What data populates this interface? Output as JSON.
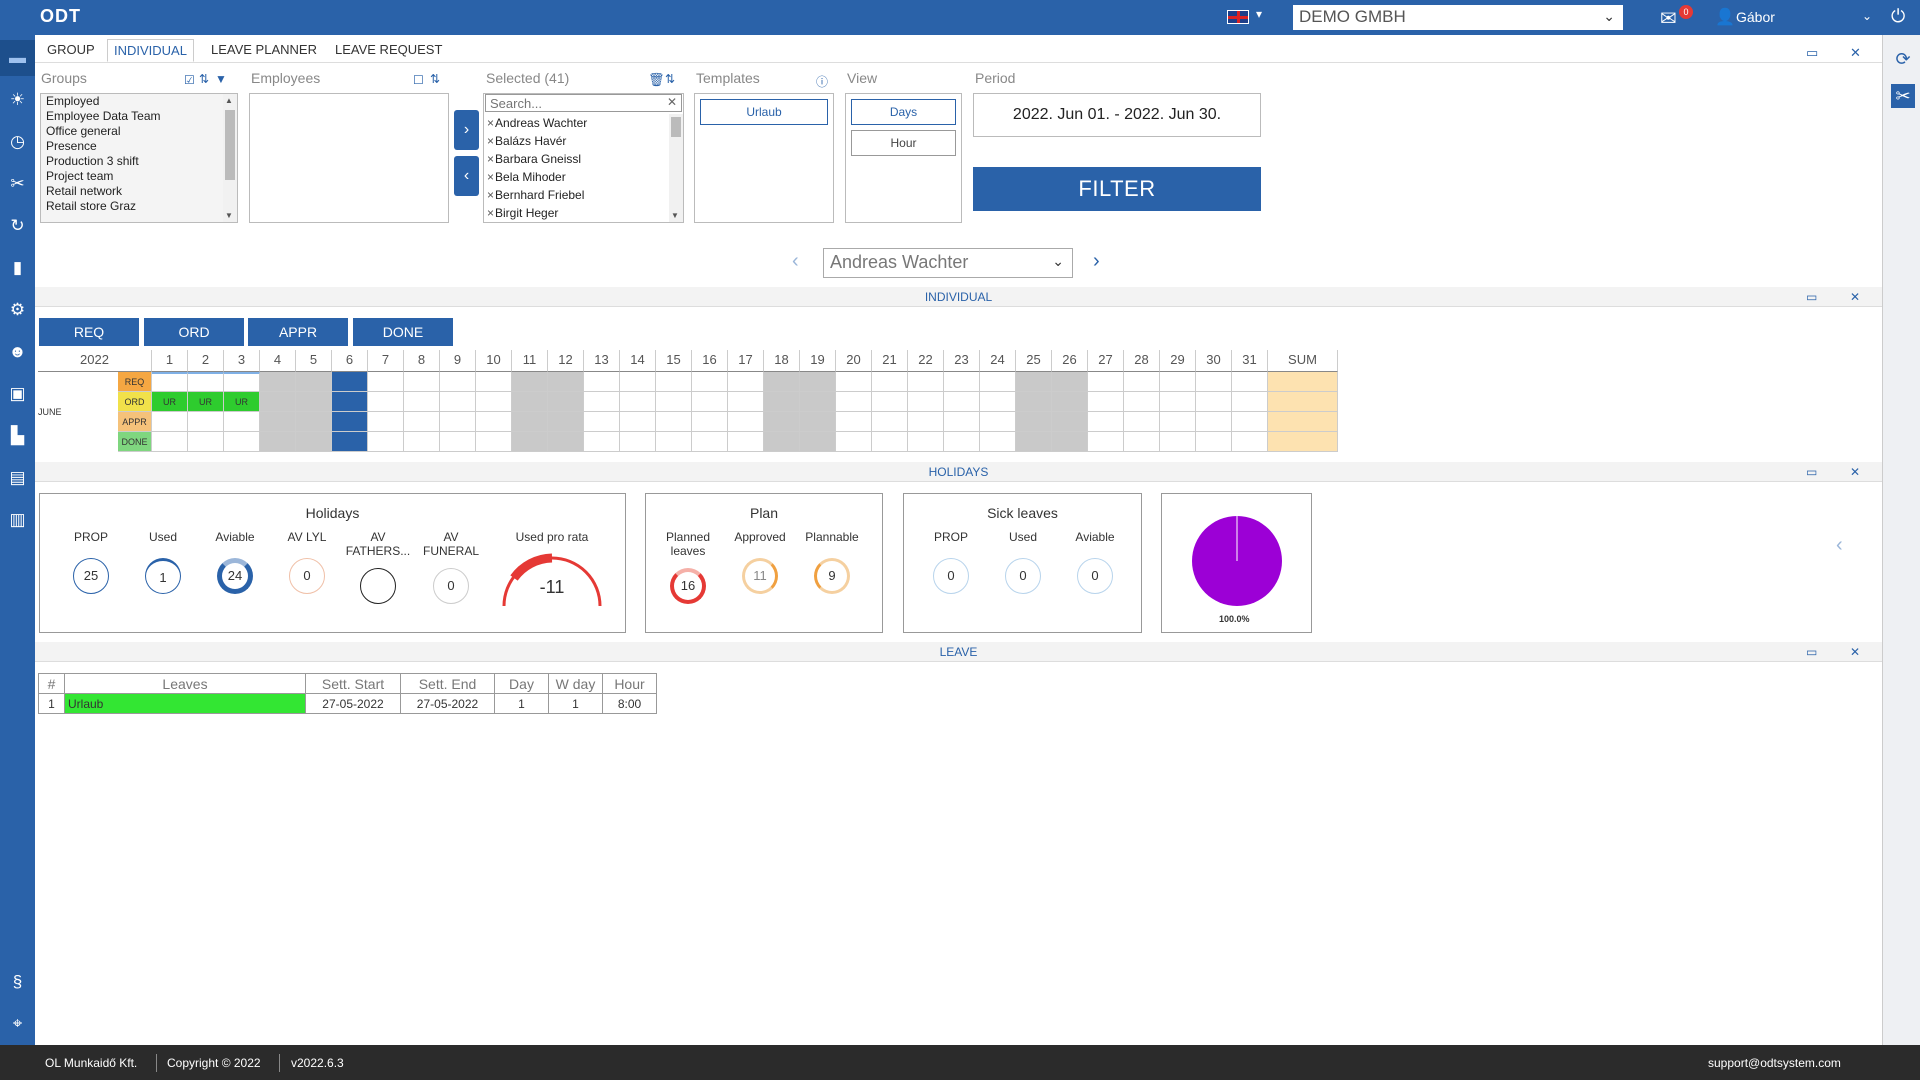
{
  "app": {
    "logo": "ODT",
    "company": "DEMO GMBH",
    "mail_count": "0",
    "user": "Gábor"
  },
  "tabs": [
    "GROUP",
    "INDIVIDUAL",
    "LEAVE PLANNER",
    "LEAVE REQUEST"
  ],
  "filter": {
    "groups_label": "Groups",
    "groups": [
      "Employed",
      "Employee Data Team",
      "Office general",
      "Presence",
      "Production 3 shift",
      "Project team",
      "Retail network",
      "Retail store Graz"
    ],
    "employees_label": "Employees",
    "selected_label": "Selected (41)",
    "search_placeholder": "Search...",
    "selected": [
      "Andreas Wachter",
      "Balázs Havér",
      "Barbara Gneissl",
      "Bela Mihoder",
      "Bernhard Friebel",
      "Birgit Heger"
    ],
    "templates_label": "Templates",
    "template": "Urlaub",
    "view_label": "View",
    "view_days": "Days",
    "view_hour": "Hour",
    "period_label": "Period",
    "period": "2022. Jun 01. - 2022. Jun 30.",
    "filter_button": "FILTER",
    "employee": "Andreas Wachter"
  },
  "sections": {
    "individual": "INDIVIDUAL",
    "holidays": "HOLIDAYS",
    "leave": "LEAVE"
  },
  "status_buttons": [
    "REQ",
    "ORD",
    "APPR",
    "DONE"
  ],
  "calendar": {
    "year": "2022",
    "month": "JUNE",
    "days": [
      "1",
      "2",
      "3",
      "4",
      "5",
      "6",
      "7",
      "8",
      "9",
      "10",
      "11",
      "12",
      "13",
      "14",
      "15",
      "16",
      "17",
      "18",
      "19",
      "20",
      "21",
      "22",
      "23",
      "24",
      "25",
      "26",
      "27",
      "28",
      "29",
      "30",
      "31"
    ],
    "sum_label": "SUM",
    "row_labels": [
      "REQ",
      "ORD",
      "APPR",
      "DONE"
    ],
    "ord_entry": "UR",
    "colors": {
      "req": "#f5a742",
      "ord": "#f1e14a",
      "appr": "#f5c27a",
      "done": "#7fd67f",
      "ord_fill": "#2ecc2e",
      "weekend": "#c9c9c9",
      "today": "#2a62a9",
      "sum": "#fde2b0"
    }
  },
  "holidays": {
    "title": "Holidays",
    "metrics": [
      {
        "label": "PROP",
        "value": "25"
      },
      {
        "label": "Used",
        "value": "1"
      },
      {
        "label": "Aviable",
        "value": "24"
      },
      {
        "label": "AV LYL",
        "value": "0"
      },
      {
        "label": "AV FATHERS...",
        "value": ""
      },
      {
        "label": "AV FUNERAL",
        "value": "0"
      }
    ],
    "pro_rata_label": "Used pro rata",
    "pro_rata_value": "-11"
  },
  "plan": {
    "title": "Plan",
    "metrics": [
      {
        "label": "Planned leaves",
        "value": "16"
      },
      {
        "label": "Approved",
        "value": "11"
      },
      {
        "label": "Plannable",
        "value": "9"
      }
    ]
  },
  "sick": {
    "title": "Sick leaves",
    "metrics": [
      {
        "label": "PROP",
        "value": "0"
      },
      {
        "label": "Used",
        "value": "0"
      },
      {
        "label": "Aviable",
        "value": "0"
      }
    ]
  },
  "pie": {
    "label": "100.0%",
    "color": "#9c00d6"
  },
  "leave_table": {
    "headers": [
      "#",
      "Leaves",
      "Sett. Start",
      "Sett. End",
      "Day",
      "W day",
      "Hour"
    ],
    "rows": [
      [
        "1",
        "Urlaub",
        "27-05-2022",
        "27-05-2022",
        "1",
        "1",
        "8:00"
      ]
    ],
    "leave_color": "#33e633"
  },
  "footer": {
    "company": "OL Munkaidő Kft.",
    "copyright": "Copyright © 2022",
    "version": "v2022.6.3",
    "support": "support@odtsystem.com"
  }
}
